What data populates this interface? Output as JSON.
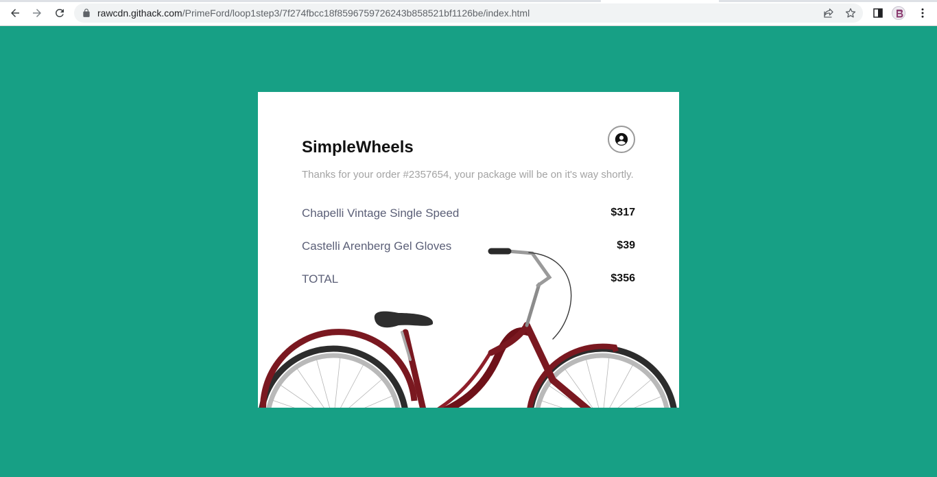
{
  "browser": {
    "url_host": "rawcdn.githack.com",
    "url_path": "/PrimeFord/loop1step3/7f274fbcc18f8596759726243b858521bf1126be/index.html",
    "icons": {
      "back": "back-arrow-icon",
      "forward": "forward-arrow-icon",
      "reload": "reload-icon",
      "lock": "lock-icon",
      "share": "share-icon",
      "bookmark": "star-icon",
      "side_panel": "side-panel-icon",
      "profile": "profile-avatar",
      "menu": "kebab-menu-icon"
    }
  },
  "page": {
    "background_color": "#17a085",
    "brand": "SimpleWheels",
    "message": "Thanks for your order #2357654, your package will be on it's way shortly.",
    "account_icon": "user-circle-icon",
    "items": [
      {
        "name": "Chapelli Vintage Single Speed",
        "price": "$317"
      },
      {
        "name": "Castelli Arenberg Gel Gloves",
        "price": "$39"
      }
    ],
    "total": {
      "label": "TOTAL",
      "price": "$356"
    },
    "hero_image": "bicycle-image"
  }
}
